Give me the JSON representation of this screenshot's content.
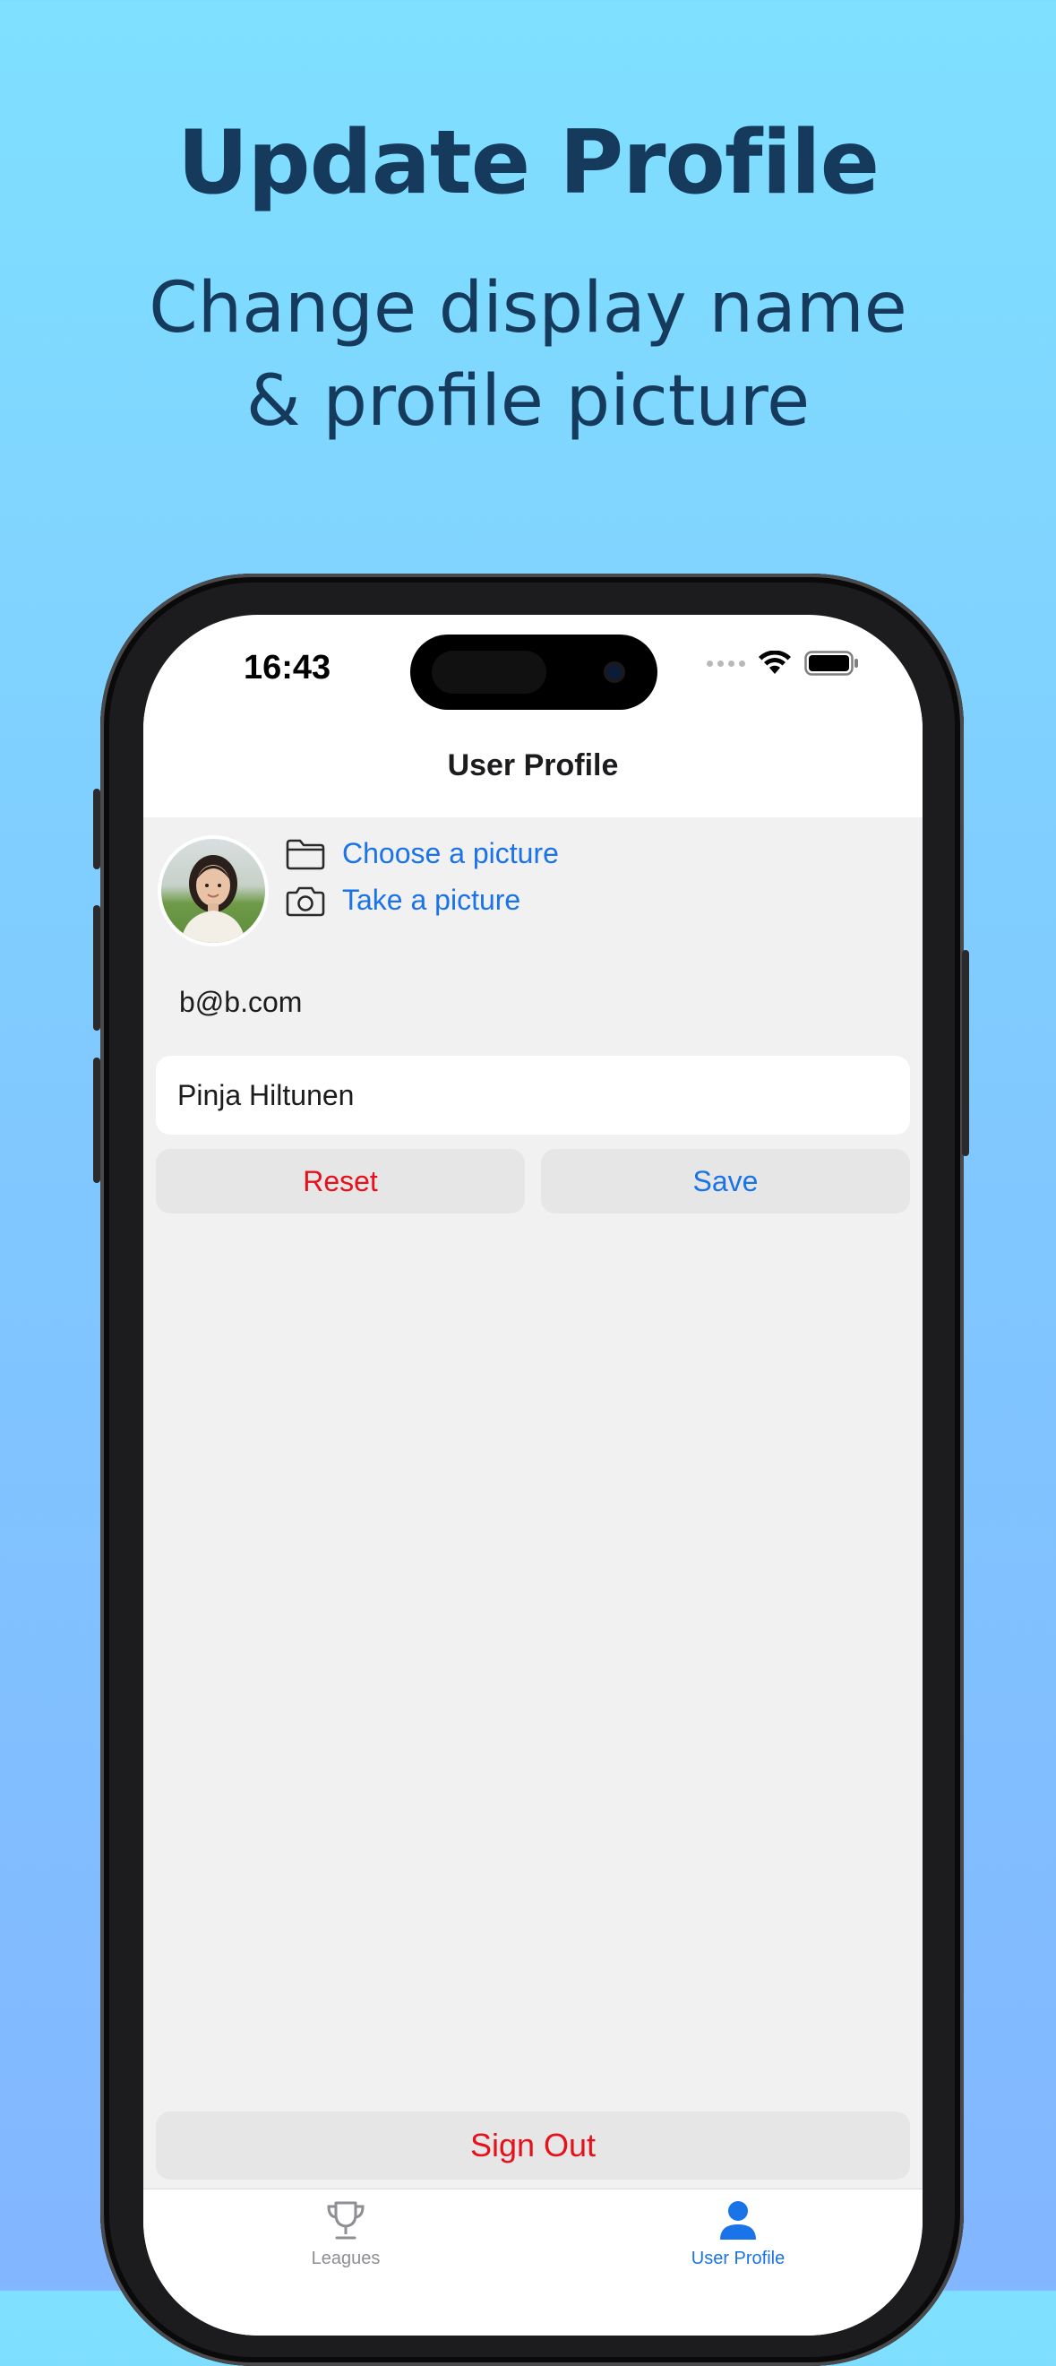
{
  "promo": {
    "title": "Update Profile",
    "subtitle_line1": "Change display name",
    "subtitle_line2": "& profile picture"
  },
  "status_bar": {
    "time": "16:43"
  },
  "navbar": {
    "title": "User Profile"
  },
  "profile": {
    "avatar_icon": "user-photo",
    "choose_picture_label": "Choose a picture",
    "take_picture_label": "Take a picture",
    "email": "b@b.com",
    "display_name_value": "Pinja Hiltunen",
    "reset_label": "Reset",
    "save_label": "Save",
    "sign_out_label": "Sign Out"
  },
  "tabbar": {
    "items": [
      {
        "label": "Leagues",
        "icon": "trophy-icon",
        "selected": false
      },
      {
        "label": "User Profile",
        "icon": "person-icon",
        "selected": true
      }
    ]
  },
  "colors": {
    "accent_blue": "#1a73e8",
    "destructive_red": "#e8101a",
    "headline": "#163a5c",
    "background_top": "#7fe0ff",
    "background_bottom": "#82b6ff"
  }
}
